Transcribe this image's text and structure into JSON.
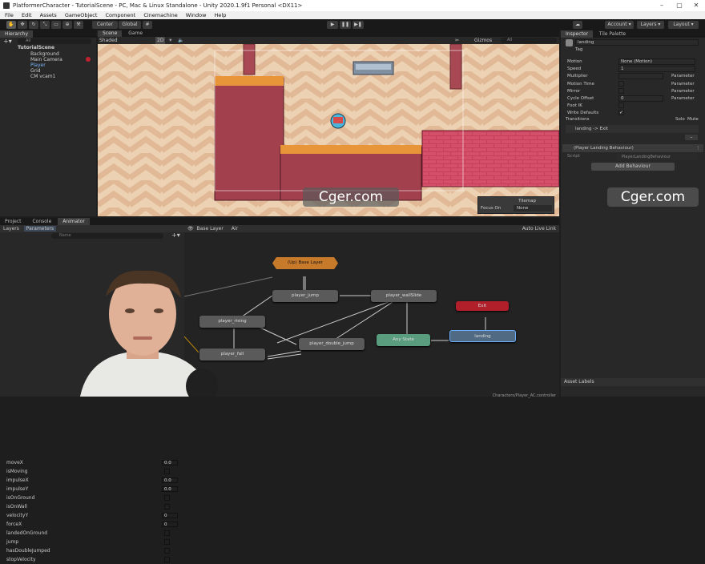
{
  "window": {
    "title": "PlatformerCharacter - TutorialScene - PC, Mac & Linux Standalone - Unity 2020.1.9f1 Personal <DX11>"
  },
  "menu": [
    "File",
    "Edit",
    "Assets",
    "GameObject",
    "Component",
    "Cinemachine",
    "Window",
    "Help"
  ],
  "toolbar": {
    "center": "Center",
    "global": "Global",
    "account": "Account",
    "layers": "Layers",
    "layout": "Layout"
  },
  "hierarchy": {
    "tab": "Hierarchy",
    "search_placeholder": "All",
    "items": [
      {
        "label": "TutorialScene"
      },
      {
        "label": "Background"
      },
      {
        "label": "Main Camera"
      },
      {
        "label": "Player"
      },
      {
        "label": "Grid"
      },
      {
        "label": "CM vcam1"
      }
    ]
  },
  "scene": {
    "tab_scene": "Scene",
    "tab_game": "Game",
    "shading": "Shaded",
    "mode": "2D",
    "gizmos": "Gizmos",
    "search_placeholder": "All",
    "tilemap_title": "Tilemap",
    "focus_label": "Focus On",
    "focus_value": "None"
  },
  "bottom_tabs": {
    "project": "Project",
    "console": "Console",
    "animator": "Animator"
  },
  "animator": {
    "tab_layers": "Layers",
    "tab_parameters": "Parameters",
    "search_placeholder": "Name",
    "breadcrumb_base": "Base Layer",
    "breadcrumb_sub": "Air",
    "auto_live_link": "Auto Live Link",
    "path": "Characters/Player_AC.controller",
    "parameters": [
      {
        "name": "moveX",
        "value": "0.0"
      },
      {
        "name": "isMoving",
        "value": ""
      },
      {
        "name": "impulseX",
        "value": "0.0"
      },
      {
        "name": "impulseY",
        "value": "0.0"
      },
      {
        "name": "isOnGround",
        "value": ""
      },
      {
        "name": "isOnWall",
        "value": ""
      },
      {
        "name": "velocityY",
        "value": "0"
      },
      {
        "name": "forceX",
        "value": "0"
      },
      {
        "name": "landedOnGround",
        "value": ""
      },
      {
        "name": "jump",
        "value": ""
      },
      {
        "name": "hasDoubleJumped",
        "value": ""
      },
      {
        "name": "stopVelocity",
        "value": ""
      }
    ],
    "nodes": {
      "up": "(Up) Base Layer",
      "jump": "player_jump",
      "wallslide": "player_wallSlide",
      "rising": "player_rising",
      "fall": "player_fall",
      "double_jump": "player_double_jump",
      "any": "Any State",
      "landing": "landing",
      "exit": "Exit"
    }
  },
  "inspector": {
    "tab": "Inspector",
    "tab2": "Tile Palette",
    "state_name": "landing",
    "tag": "Tag",
    "rows": [
      {
        "label": "Motion",
        "value": "None (Motion)"
      },
      {
        "label": "Speed",
        "value": "1"
      },
      {
        "label": "Multiplier",
        "value": "",
        "param": "Parameter"
      },
      {
        "label": "Motion Time",
        "value": "",
        "param": "Parameter"
      },
      {
        "label": "Mirror",
        "value": "",
        "param": "Parameter"
      },
      {
        "label": "Cycle Offset",
        "value": "0",
        "param": "Parameter"
      },
      {
        "label": "Foot IK",
        "value": ""
      },
      {
        "label": "Write Defaults",
        "value": "✓"
      }
    ],
    "transitions_label": "Transitions",
    "solo": "Solo",
    "mute": "Mute",
    "transition": "landing -> Exit",
    "behaviour": "(Player Landing Behaviour)",
    "script_label": "Script",
    "script_value": "PlayerLandingBehaviour",
    "add_behaviour": "Add Behaviour",
    "asset_labels": "Asset Labels"
  },
  "watermarks": [
    "Cger.com",
    "Cger.com"
  ]
}
